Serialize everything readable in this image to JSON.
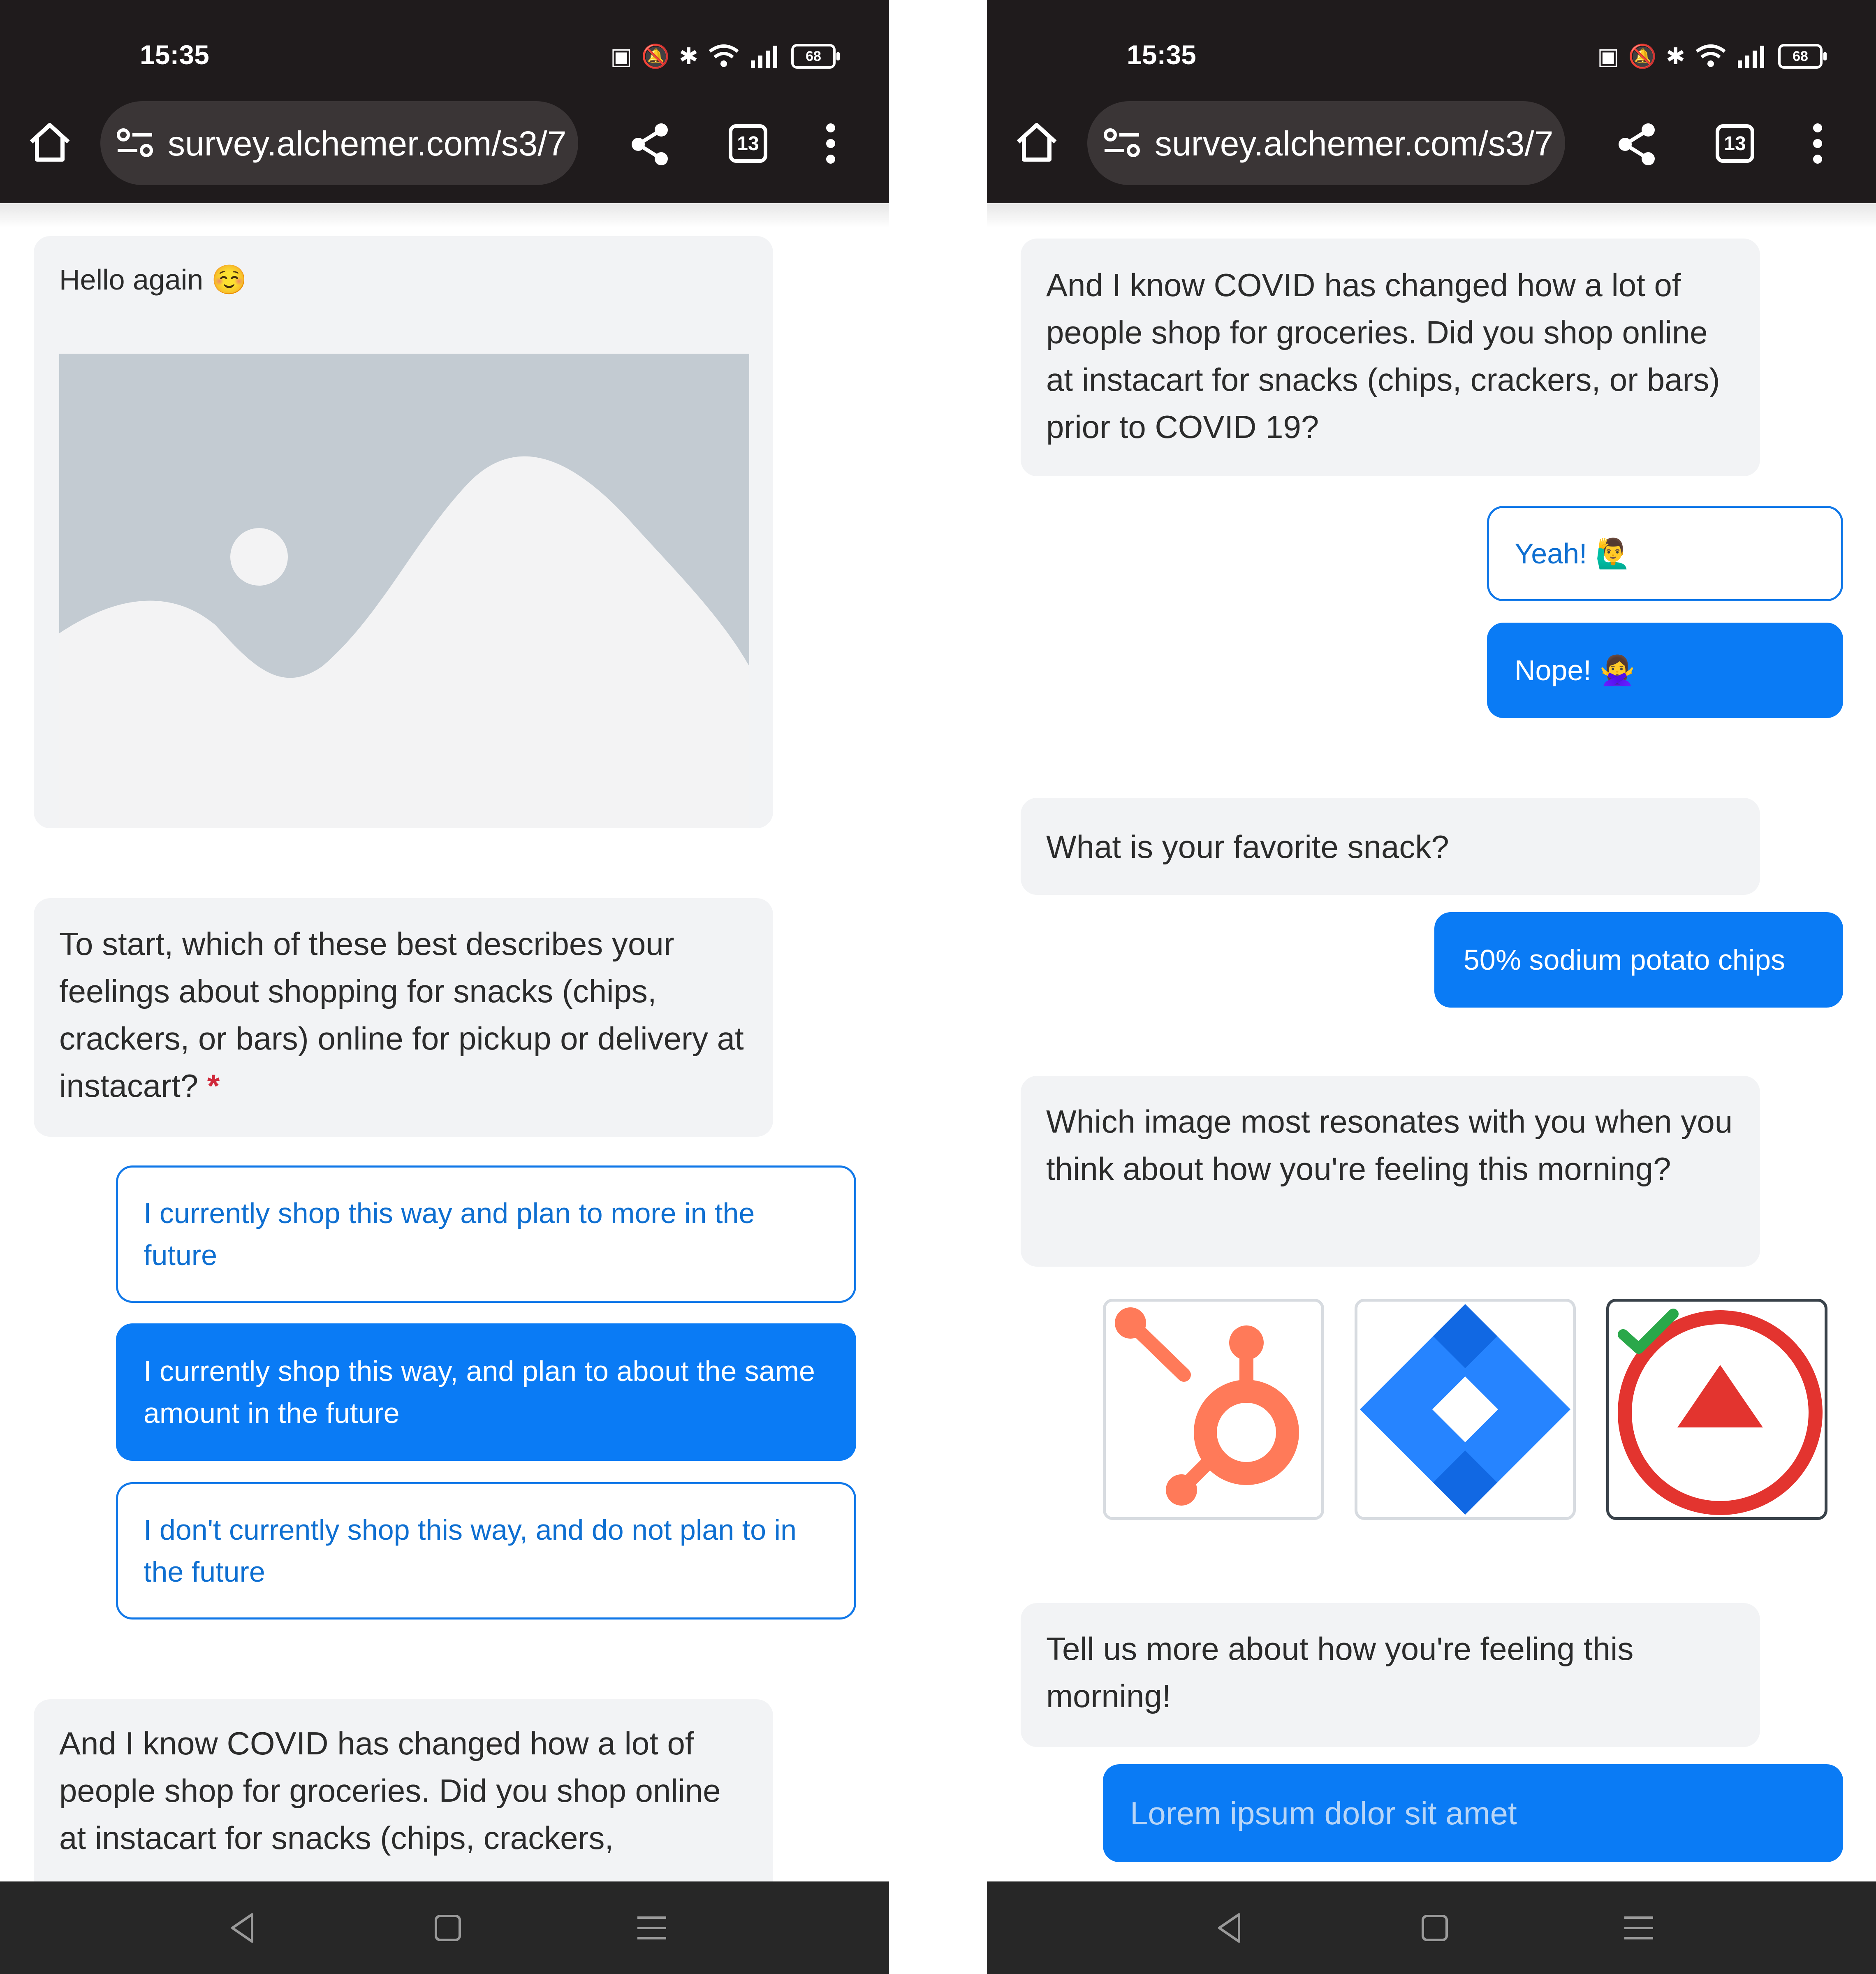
{
  "status_bar": {
    "time": "15:35",
    "battery": "68"
  },
  "browser": {
    "url": "survey.alchemer.com/s3/7",
    "tab_count": "13"
  },
  "left": {
    "greeting": "Hello again ☺️",
    "question1": "To start, which of these best describes your feelings about shopping for snacks (chips, crackers, or bars) online for pickup or delivery at instacart?",
    "required_mark": "*",
    "options": [
      {
        "label": "I currently shop this way and plan to more in the future",
        "selected": false
      },
      {
        "label": "I currently shop this way, and plan to about the same amount in the future",
        "selected": true
      },
      {
        "label": "I don't currently shop this way, and do not plan to in the future",
        "selected": false
      }
    ],
    "question2_partial": "And I know COVID has changed how a lot of people shop for groceries. Did you shop online at instacart for snacks (chips, crackers,"
  },
  "right": {
    "question2": "And I know COVID has changed how a lot of people shop for groceries. Did you shop online at instacart for snacks (chips, crackers, or bars) prior to COVID 19?",
    "yes_answer": "Yeah! 🙋‍♂️",
    "no_answer": "Nope! 🙅‍♀️",
    "question3": "What is your favorite snack?",
    "answer3": "50% sodium potato chips",
    "question4": "Which image most resonates with you when you think about how you're feeling this morning?",
    "image_choices": [
      "hubspot-logo",
      "jira-logo",
      "red-triangle-logo"
    ],
    "selected_image": "red-triangle-logo",
    "question5": "Tell us more about how you're feeling this morning!",
    "answer5_placeholder": "Lorem ipsum dolor sit amet"
  },
  "colors": {
    "accent": "#0a7bf5",
    "bubble_bg": "#f2f3f5",
    "topbar_bg": "#1f1b1c",
    "hubspot": "#ff7a59",
    "jira": "#2684ff",
    "red": "#e3342f"
  }
}
